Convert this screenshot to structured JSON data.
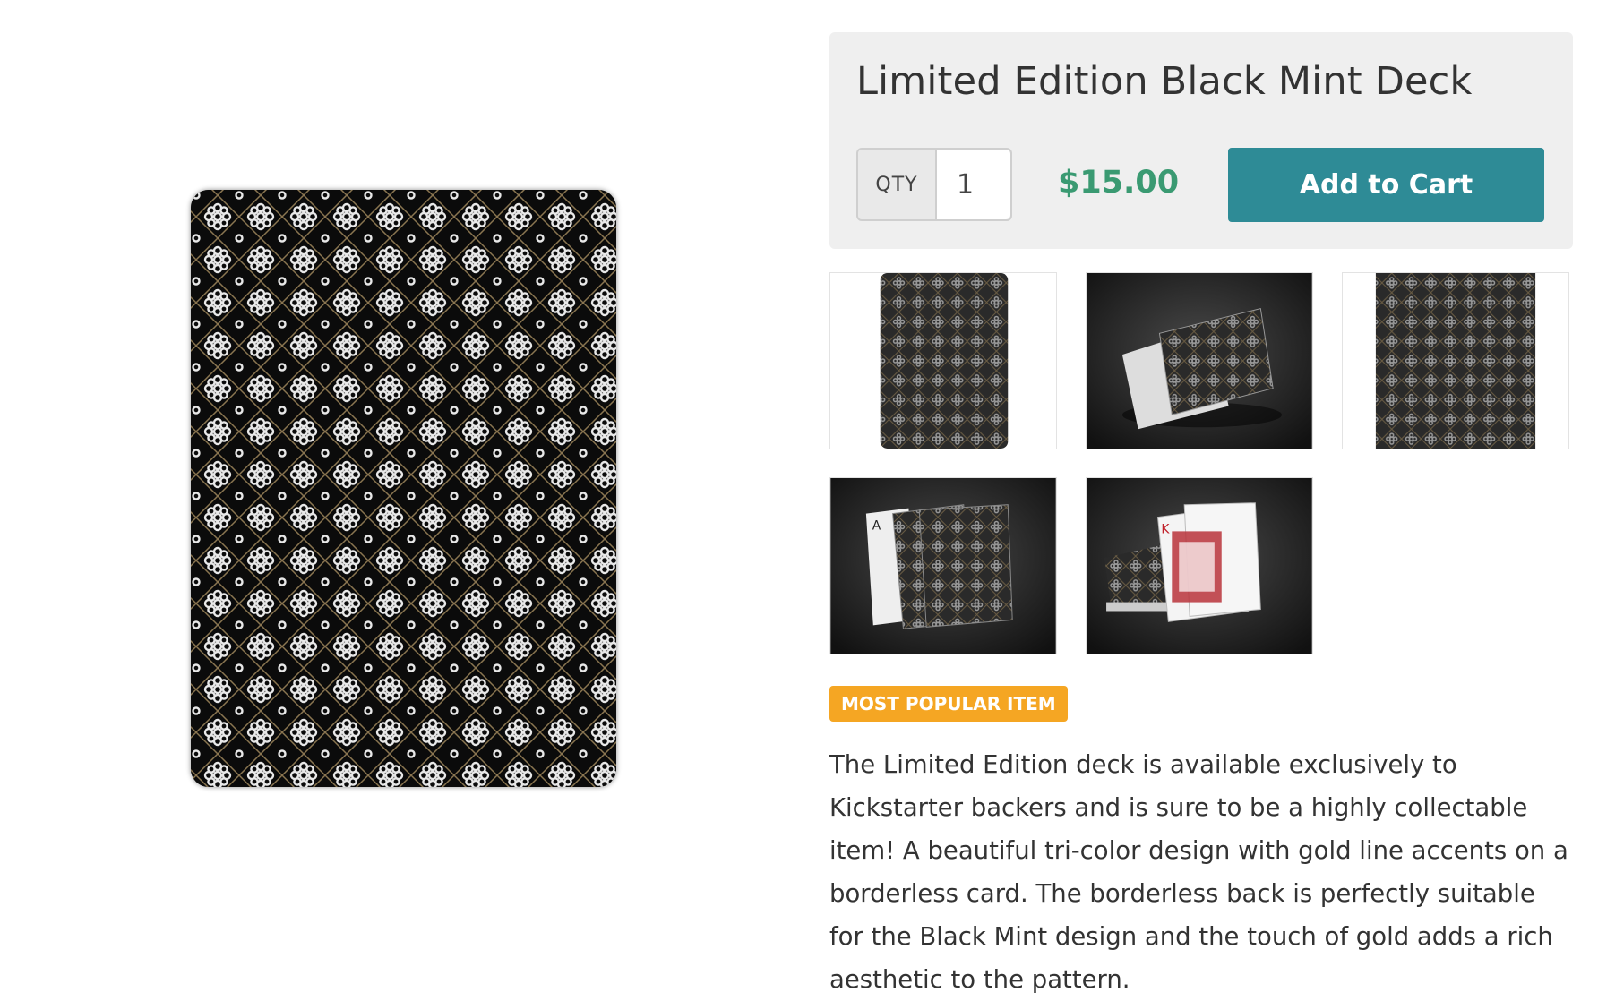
{
  "product": {
    "title": "Limited Edition Black Mint Deck",
    "qty_label": "QTY",
    "qty_value": "1",
    "price": "$15.00",
    "add_to_cart_label": "Add to Cart",
    "badge": "MOST POPULAR ITEM",
    "description": "The Limited Edition deck is available exclusively to Kickstarter backers and is sure to be a highly collectable item! A beautiful tri-color design with gold line accents on a borderless card. The borderless back is perfectly suitable for the Black Mint design and the touch of gold adds a rich aesthetic to the pattern."
  },
  "colors": {
    "price": "#3a9a72",
    "button": "#2e8b96",
    "badge": "#f5a623",
    "card_back": "#0b0b0b",
    "pattern_white": "#e8e8e8",
    "pattern_gold": "#8a7550"
  },
  "thumbnails": [
    {
      "name": "card-back-flat"
    },
    {
      "name": "deck-angled-dark"
    },
    {
      "name": "card-back-closeup"
    },
    {
      "name": "fanned-cards-ace"
    },
    {
      "name": "deck-with-face-cards"
    }
  ]
}
